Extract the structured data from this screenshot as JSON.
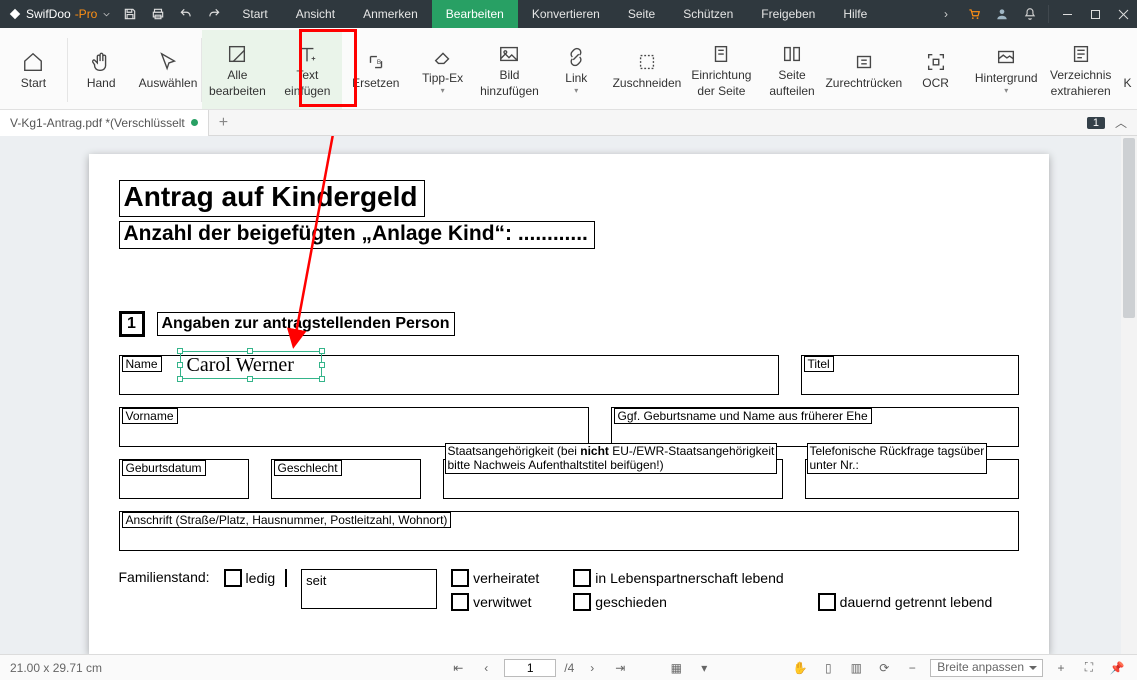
{
  "app": {
    "name_a": "SwifDoo",
    "name_b": "-Pro"
  },
  "menu": [
    "Start",
    "Ansicht",
    "Anmerken",
    "Bearbeiten",
    "Konvertieren",
    "Seite",
    "Schützen",
    "Freigeben",
    "Hilfe"
  ],
  "active_menu": "Bearbeiten",
  "ribbon": {
    "start": "Start",
    "hand": "Hand",
    "select": "Auswählen",
    "edit_all": "Alle bearbeiten",
    "insert_text": "Text einfügen",
    "replace": "Ersetzen",
    "tippex": "Tipp-Ex",
    "add_image": "Bild hinzufügen",
    "link": "Link",
    "crop": "Zuschneiden",
    "page_setup": "Einrichtung der Seite",
    "split": "Seite aufteilen",
    "indent": "Zurechtrücken",
    "ocr": "OCR",
    "background": "Hintergrund",
    "toc": "Verzeichnis extrahieren",
    "more": "K"
  },
  "tab": {
    "title": "V-Kg1-Antrag.pdf *(Verschlüsselt"
  },
  "tab_right_count": "1",
  "doc": {
    "h1": "Antrag auf Kindergeld",
    "h2": "Anzahl der beigefügten „Anlage Kind“: ............",
    "sec_num": "1",
    "sec_title": "Angaben zur antragstellenden Person",
    "name_lbl": "Name",
    "titel_lbl": "Titel",
    "vorname_lbl": "Vorname",
    "ggf_lbl": "Ggf. Geburtsname und Name aus früherer Ehe",
    "geb_lbl": "Geburtsdatum",
    "gesch_lbl": "Geschlecht",
    "staat_l1": "Staatsangehörigkeit (bei ",
    "staat_b": "nicht",
    "staat_l2": " EU-/EWR-Staatsangehörigkeit",
    "staat_l3": "bitte Nachweis Aufenthaltstitel beifügen!)",
    "tel_l1": "Telefonische Rückfrage tagsüber",
    "tel_l2": "unter Nr.:",
    "anschrift": "Anschrift (Straße/Platz, Hausnummer, Postleitzahl, Wohnort)",
    "fam_lbl": "Familienstand:",
    "ledig": "ledig",
    "seit": "seit",
    "verheiratet": "verheiratet",
    "verwitwet": "verwitwet",
    "lp": "in Lebenspartnerschaft lebend",
    "geschieden": "geschieden",
    "getrennt": "dauernd getrennt lebend",
    "inserted_text": "Carol Werner"
  },
  "status": {
    "dims": "21.00 x 29.71 cm",
    "page_current": "1",
    "page_total": "/4",
    "zoom": "Breite anpassen"
  }
}
